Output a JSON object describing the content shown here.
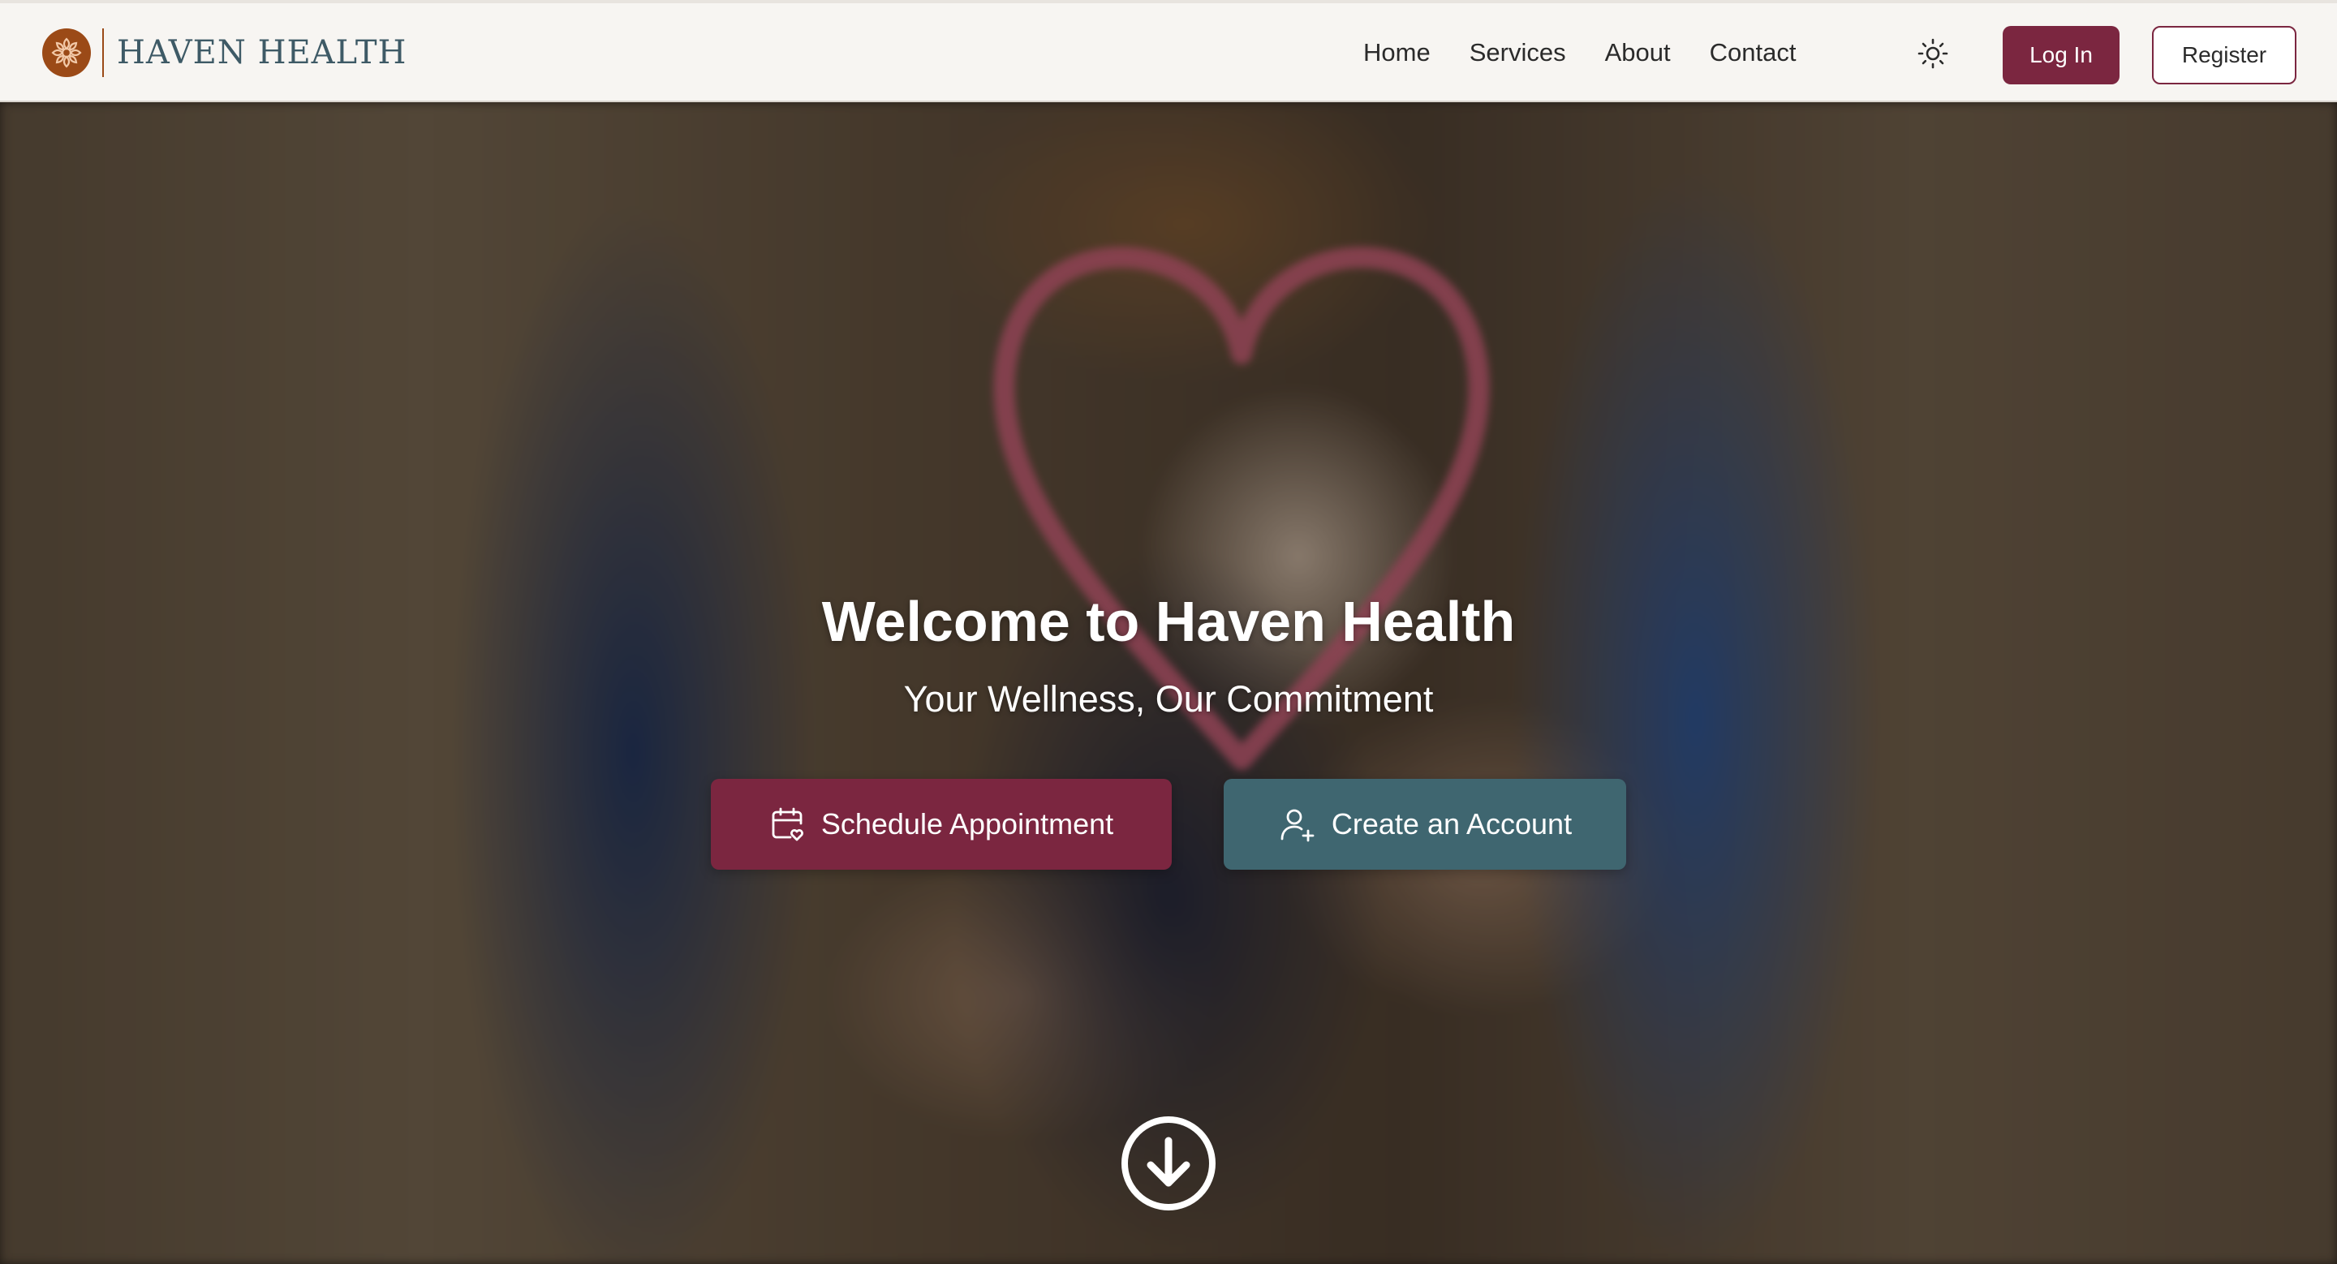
{
  "brand": {
    "name": "HAVEN HEALTH",
    "logo_icon": "flower-cross-icon",
    "logo_color": "#9b4a17"
  },
  "nav": {
    "links": [
      {
        "label": "Home"
      },
      {
        "label": "Services"
      },
      {
        "label": "About"
      },
      {
        "label": "Contact"
      }
    ],
    "theme_toggle_icon": "sun-icon",
    "login_label": "Log In",
    "register_label": "Register"
  },
  "hero": {
    "title": "Welcome to Haven Health",
    "subtitle": "Your Wellness, Our Commitment",
    "primary_cta": {
      "label": "Schedule Appointment",
      "icon": "calendar-heart-icon"
    },
    "secondary_cta": {
      "label": "Create an Account",
      "icon": "user-plus-icon"
    },
    "scroll_icon": "arrow-down-circle-icon"
  },
  "colors": {
    "primary": "#7b2640",
    "secondary": "#3f6670",
    "navbar_bg": "#f7f5f2",
    "brand_text": "#3e5a66"
  }
}
